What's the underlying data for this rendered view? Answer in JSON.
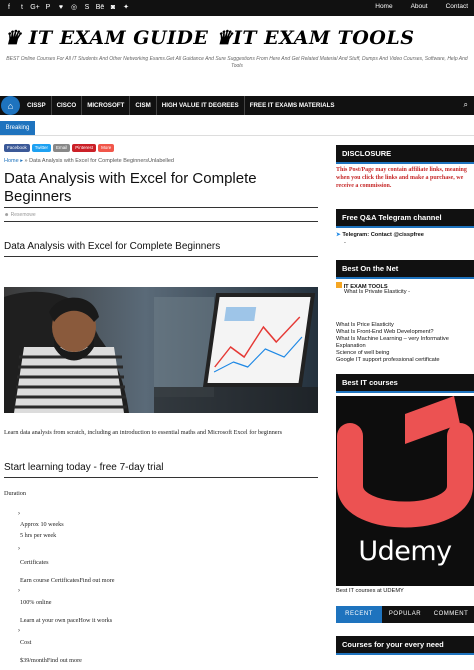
{
  "topbar": {
    "social_icons": [
      "facebook-icon",
      "twitter-icon",
      "google-plus-icon",
      "pinterest-icon",
      "heart-icon",
      "rss-icon",
      "skype-icon",
      "behance-icon",
      "instagram-icon",
      "share-icon"
    ],
    "social_glyphs": [
      "f",
      "t",
      "G+",
      "P",
      "♥",
      "◎",
      "S",
      "Bē",
      "◙",
      "✦"
    ],
    "links": [
      "Home",
      "About",
      "Contact"
    ]
  },
  "header": {
    "logo": "♛ IT EXAM GUIDE ♛IT EXAM TOOLS",
    "tagline": "BEST Online Courses For All IT Students And Other Networking Exams.Get All Guidance And Sure Suggestions From Here And Get Related Material And Stuff, Dumps And Video Courses, Software, Help And Tools"
  },
  "nav": {
    "home_glyph": "⌂",
    "items": [
      "CISSP",
      "CISCO",
      "MICROSOFT",
      "CISM",
      "HIGH VALUE IT DEGREES",
      "FREE IT EXAMS MATERIALS"
    ],
    "search_glyph": "⌕"
  },
  "breaking": "Breaking",
  "share": [
    "Facebook",
    "Twitter",
    "Email",
    "Pinterest",
    "More"
  ],
  "post": {
    "breadcrumb_home": "Home",
    "breadcrumb_sep": "▸",
    "breadcrumb_rest": "» Data Analysis with Excel for Complete BeginnersUnlabelled",
    "title": "Data Analysis with Excel for Complete Beginners",
    "author": "Resemowe",
    "subtitle": "Data Analysis with Excel for Complete Beginners",
    "intro": "Learn data analysis from scratch, including an introduction to essential maths and Microsoft Excel for beginners",
    "trial_heading": "Start learning today - free 7-day trial",
    "duration_label": "Duration",
    "chevron": "›",
    "weeks": "Approx 10 weeks",
    "hours": "5 hrs per week",
    "certificates_label": "Certificates",
    "earn_certs": "Earn course CertificatesFind out more",
    "online": "100% online",
    "pace": "Learn at your own paceHow it works",
    "cost_label": "Cost",
    "cost": "$39/monthFind out more"
  },
  "sidebar": {
    "disclosure_head": "DISCLOSURE",
    "disclosure_text": "This Post/Page may contain affiliate links, meaning when you click the links and make a purchase, we receive a commission.",
    "telegram_head": "Free Q&A Telegram channel",
    "telegram_text": "Telegram: Contact @cisspfree",
    "telegram_dash": "-",
    "best_head": "Best On the Net",
    "best_site": "IT EXAM TOOLS",
    "best_site_sub": "What Is Private Elasticity -",
    "links": [
      "What Is Price Elasticity",
      "What Is Front-End Web Development?",
      "What Is Machine Learning – very Informative Explanation",
      "Science of well being",
      "Google IT support professional certificate"
    ],
    "courses_head": "Best IT courses",
    "udemy_word": "Udemy",
    "udemy_caption": "Best IT courses at UDEMY",
    "tabs": [
      "RECENT",
      "POPULAR",
      "COMMENT"
    ],
    "next_head": "Courses for your every need"
  },
  "colors": {
    "accent": "#1e73be",
    "dark": "#111111",
    "udemy_red": "#ec5252",
    "disclosure_red": "#c62828"
  }
}
